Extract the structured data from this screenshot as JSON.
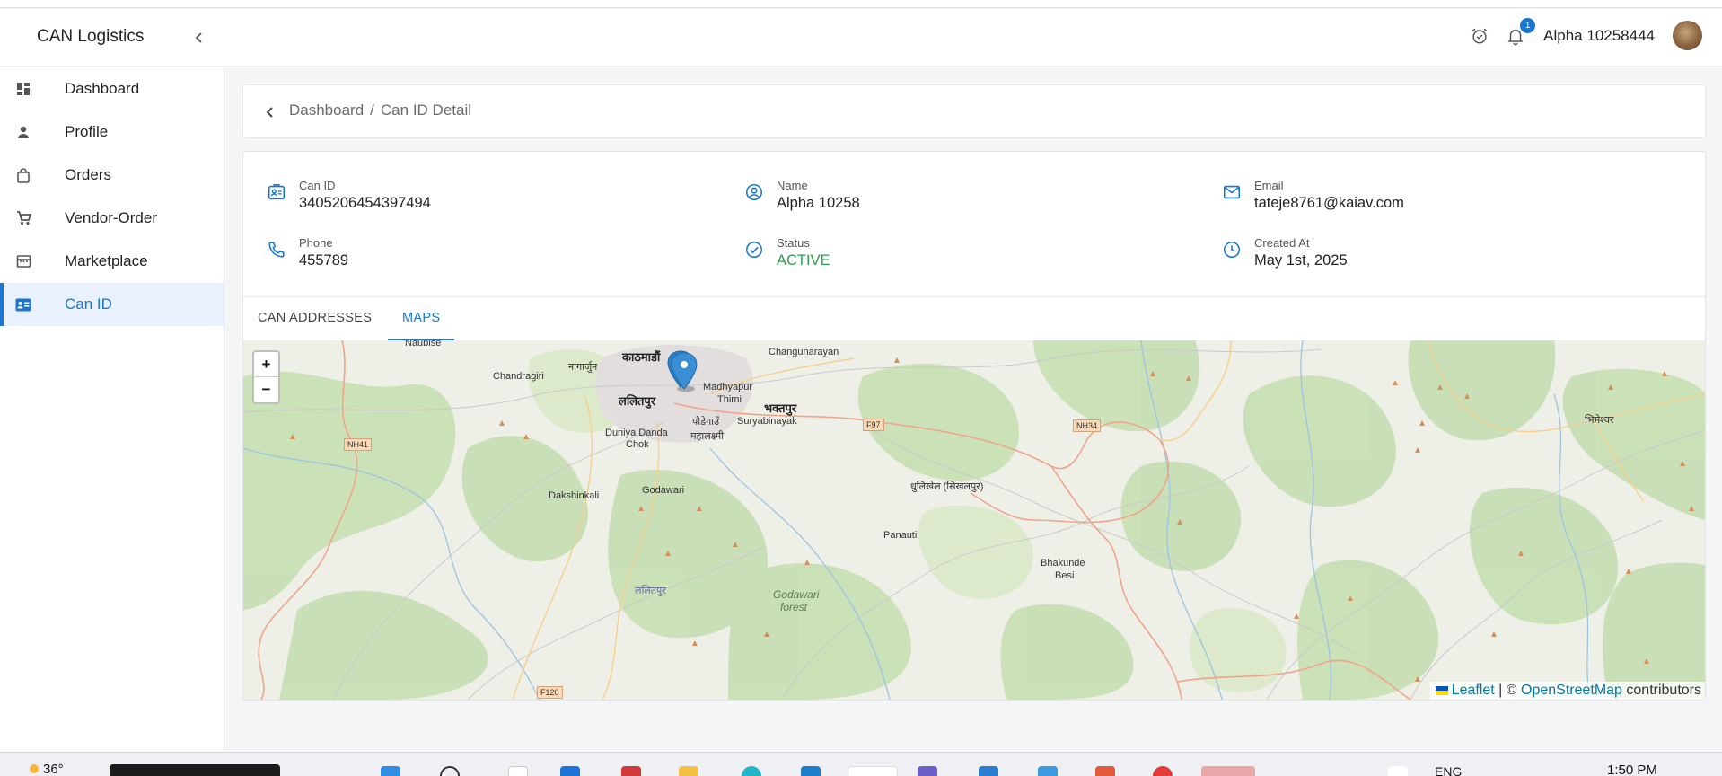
{
  "app": {
    "brand": "CAN Logistics"
  },
  "header": {
    "user_name": "Alpha 10258444",
    "notification_count": "1"
  },
  "sidebar": {
    "items": [
      {
        "label": "Dashboard",
        "icon": "dashboard-icon",
        "active": false
      },
      {
        "label": "Profile",
        "icon": "person-icon",
        "active": false
      },
      {
        "label": "Orders",
        "icon": "shopping-bag-icon",
        "active": false
      },
      {
        "label": "Vendor-Order",
        "icon": "cart-icon",
        "active": false
      },
      {
        "label": "Marketplace",
        "icon": "store-icon",
        "active": false
      },
      {
        "label": "Can ID",
        "icon": "id-card-icon",
        "active": true
      }
    ]
  },
  "breadcrumb": {
    "parent": "Dashboard",
    "separator": "/",
    "current": "Can ID Detail"
  },
  "details": {
    "can_id": {
      "label": "Can ID",
      "value": "3405206454397494"
    },
    "name": {
      "label": "Name",
      "value": "Alpha 10258"
    },
    "email": {
      "label": "Email",
      "value": "tateje8761@kaiav.com"
    },
    "phone": {
      "label": "Phone",
      "value": "455789"
    },
    "status": {
      "label": "Status",
      "value": "ACTIVE"
    },
    "created_at": {
      "label": "Created At",
      "value": "May 1st, 2025"
    }
  },
  "tabs": [
    {
      "label": "CAN ADDRESSES",
      "selected": false
    },
    {
      "label": "MAPS",
      "selected": true
    }
  ],
  "map": {
    "zoom_in": "+",
    "zoom_out": "−",
    "attribution": {
      "leaflet": "Leaflet",
      "separator": " | © ",
      "osm": "OpenStreetMap",
      "suffix": " contributors"
    },
    "places": {
      "naubise": "Naubise",
      "chandragiri": "Chandragiri",
      "nagarjun": "नागार्जुन",
      "kathmandu": "काठमाडौं",
      "changunarayan": "Changunarayan",
      "madhyapur": "Madhyapur",
      "thimi": "Thimi",
      "lalitpur": "ललितपुर",
      "bhaktapur": "भक्तपुर",
      "pidhaun": "पौडेगाउँ",
      "mahalaxmi": "महालक्ष्मी",
      "suryabinayak": "Suryabinayak",
      "duniya_danda": "Duniya Danda",
      "chok": "Chok",
      "dakshinkali": "Dakshinkali",
      "godawari": "Godawari",
      "dhulikhel": "धुलिखेल (सिखलपुर)",
      "panauti": "Panauti",
      "bhakunde": "Bhakunde",
      "besi": "Besi",
      "lalitpur_small": "ललितपुर",
      "godawari_forest_1": "Godawari",
      "godawari_forest_2": "forest",
      "bhimeshwar": "भिमेश्वर",
      "nh41": "NH41",
      "f97": "F97",
      "nh34": "NH34",
      "f120": "F120"
    }
  },
  "taskbar": {
    "temperature": "36°",
    "language": "ENG",
    "time": "1:50 PM"
  },
  "colors": {
    "accent": "#1976d2",
    "status_active": "#2e9e4f"
  }
}
